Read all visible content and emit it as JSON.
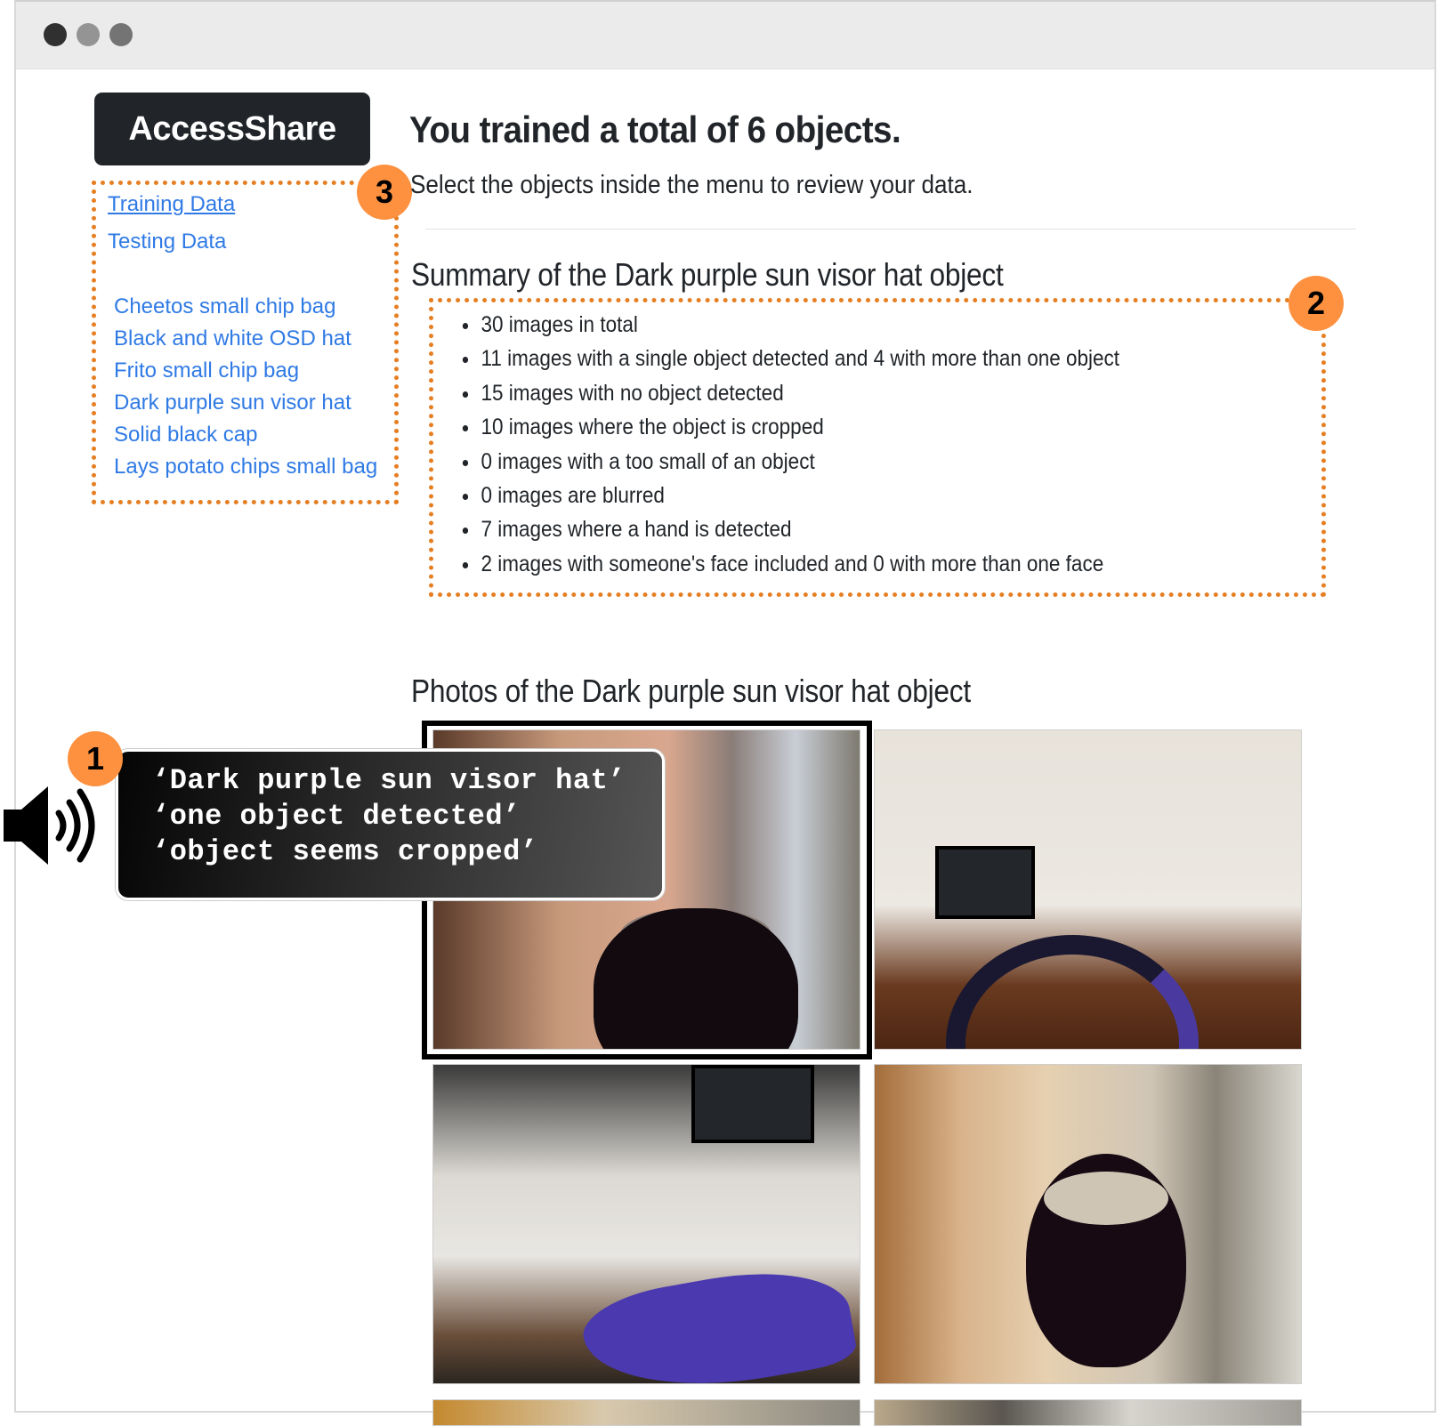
{
  "window": {
    "controls": [
      "close",
      "minimize",
      "maximize"
    ]
  },
  "brand": {
    "name": "AccessShare"
  },
  "sidebar": {
    "nav": [
      {
        "label": "Training Data",
        "active": true
      },
      {
        "label": "Testing Data",
        "active": false
      }
    ],
    "objects": [
      {
        "label": "Cheetos small chip bag"
      },
      {
        "label": "Black and white OSD hat"
      },
      {
        "label": "Frito small chip bag"
      },
      {
        "label": "Dark purple sun visor hat"
      },
      {
        "label": "Solid black cap"
      },
      {
        "label": "Lays potato chips small bag"
      }
    ]
  },
  "main": {
    "title": "You trained a total of 6 objects.",
    "lead": "Select the objects inside the menu to review your data.",
    "summary": {
      "heading": "Summary of the Dark purple sun visor hat object",
      "items": [
        "30 images in total",
        "11 images with a single object detected and 4 with more than one object",
        "15 images with no object detected",
        "10 images where the object is cropped",
        "0 images with a too small of an object",
        "0 images are blurred",
        "7 images where a hand is detected",
        "2 images with someone's face included and 0 with more than one face"
      ]
    },
    "photos": {
      "heading": "Photos of the Dark purple sun visor hat object",
      "selected_index": 0,
      "count_visible": 6
    }
  },
  "annotations": {
    "badges": [
      "1",
      "2",
      "3"
    ],
    "color": "#fd9140",
    "border_color": "#e67e22"
  },
  "speech": {
    "icon": "speaker-icon",
    "lines": [
      "‘Dark purple sun visor hat’",
      "‘one object detected’",
      "‘object seems cropped’"
    ]
  },
  "colors": {
    "link": "#2f7ae5",
    "brand_bg": "#212529",
    "text": "#212529"
  }
}
